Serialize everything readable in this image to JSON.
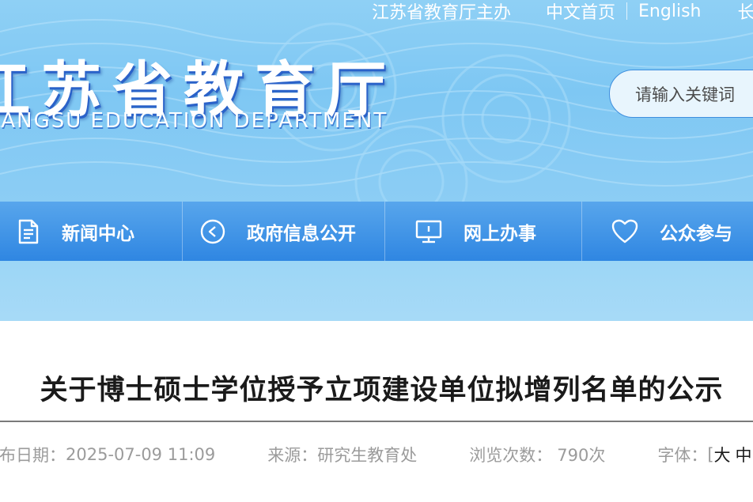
{
  "top_links": {
    "sponsor": "江苏省教育厅主办",
    "home_cn": "中文首页",
    "english": "English",
    "extra": "长"
  },
  "logo": {
    "cn": "江苏省教育厅",
    "en": "JIANGSU EDUCATION DEPARTMENT"
  },
  "search": {
    "placeholder": "请输入关键词"
  },
  "nav": {
    "items": [
      {
        "label": "新闻中心",
        "icon": "document-icon"
      },
      {
        "label": "政府信息公开",
        "icon": "play-circle-icon"
      },
      {
        "label": "网上办事",
        "icon": "monitor-icon"
      },
      {
        "label": "公众参与",
        "icon": "heart-icon"
      }
    ]
  },
  "article": {
    "title": "关于博士硕士学位授予立项建设单位拟增列名单的公示",
    "publish_label": "发布日期：",
    "publish_date": "2025-07-09 11:09",
    "source_label": "来源：",
    "source": "研究生教育处",
    "views_label": "浏览次数：",
    "views": "790次",
    "font_label": "字体：",
    "font_bracket": "[",
    "font_large": "大",
    "font_medium": "中"
  },
  "colors": {
    "header_bg": "#7ec7f3",
    "nav_bg": "#3a8ee4",
    "banner_bg": "#a2d8f6",
    "search_border": "#3f8fde"
  }
}
